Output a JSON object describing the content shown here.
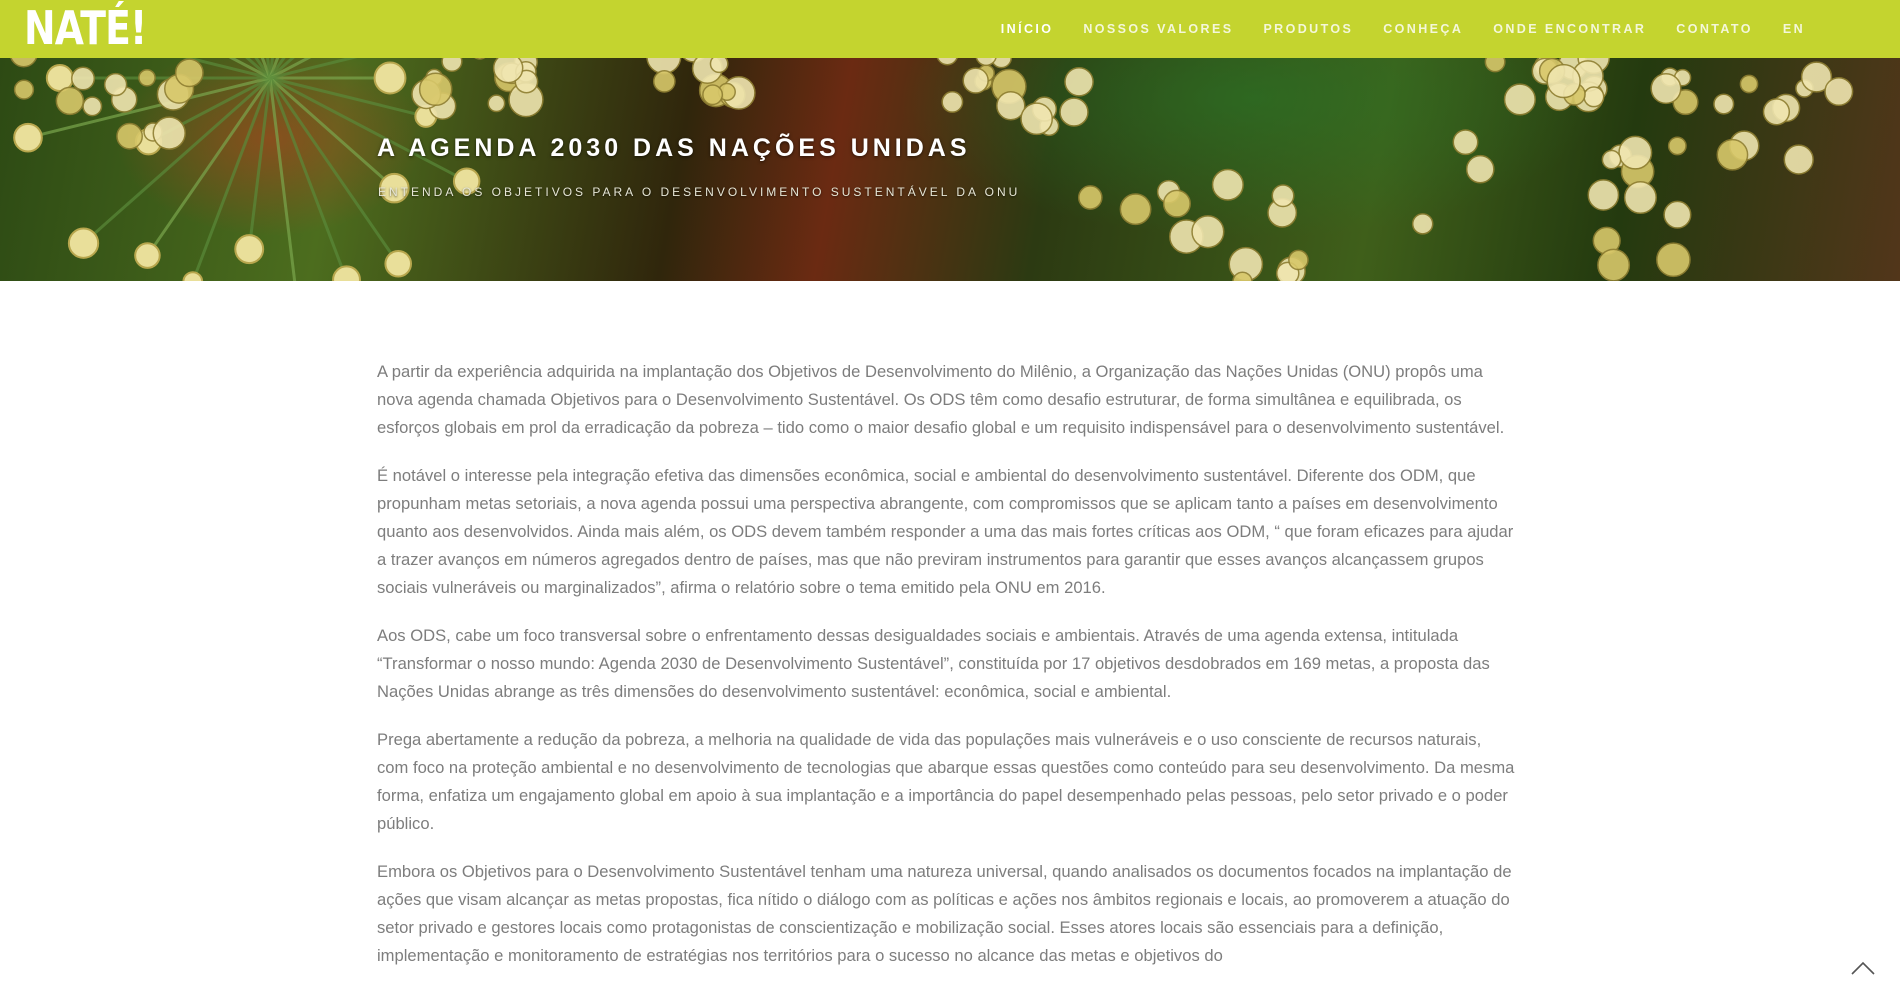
{
  "brand": {
    "logo_text": "NATÉ!"
  },
  "nav": {
    "items": [
      {
        "id": "inicio",
        "label": "INÍCIO",
        "active": true
      },
      {
        "id": "nossos-valores",
        "label": "NOSSOS VALORES",
        "active": false
      },
      {
        "id": "produtos",
        "label": "PRODUTOS",
        "active": false
      },
      {
        "id": "conheca",
        "label": "CONHEÇA",
        "active": false
      },
      {
        "id": "onde-encontrar",
        "label": "ONDE ENCONTRAR",
        "active": false
      },
      {
        "id": "contato",
        "label": "CONTATO",
        "active": false
      },
      {
        "id": "en",
        "label": "EN",
        "active": false
      }
    ]
  },
  "hero": {
    "title": "A AGENDA 2030 DAS NAÇÕES UNIDAS",
    "subtitle": "ENTENDA OS OBJETIVOS PARA O DESENVOLVIMENTO SUSTENTÁVEL DA ONU"
  },
  "article": {
    "paragraphs": [
      "A partir da experiência adquirida na implantação dos Objetivos de Desenvolvimento do Milênio, a Organização das Nações Unidas (ONU) propôs uma nova agenda chamada Objetivos para o Desenvolvimento Sustentável. Os ODS têm como desafio estruturar, de forma simultânea e equilibrada, os esforços globais em prol da erradicação da pobreza – tido como o maior desafio global e um requisito indispensável para o desenvolvimento sustentável.",
      "É notável o interesse pela integração efetiva das dimensões econômica, social e ambiental do desenvolvimento sustentável. Diferente dos ODM, que propunham metas setoriais, a nova agenda possui uma perspectiva abrangente, com compromissos que se aplicam tanto a países em desenvolvimento quanto aos desenvolvidos. Ainda mais além, os ODS devem também responder a uma das mais fortes críticas aos ODM, “ que foram eficazes para ajudar a trazer avanços em números agregados dentro de países, mas que não previram instrumentos para garantir que esses avanços alcançassem grupos sociais vulneráveis ou marginalizados”, afirma o relatório sobre o tema emitido pela ONU em 2016.",
      "Aos ODS, cabe um foco transversal sobre o enfrentamento dessas desigualdades sociais e ambientais. Através de uma agenda extensa, intitulada “Transformar o nosso mundo: Agenda 2030 de Desenvolvimento Sustentável”, constituída por 17 objetivos desdobrados em 169 metas, a proposta das Nações Unidas abrange as três dimensões do desenvolvimento sustentável: econômica, social e ambiental.",
      "Prega abertamente a redução da pobreza, a melhoria na qualidade de vida das populações mais vulneráveis e o uso consciente de recursos naturais, com foco na proteção ambiental e no desenvolvimento de tecnologias que abarque essas questões como conteúdo para seu desenvolvimento. Da mesma forma, enfatiza um engajamento global em apoio à sua implantação e a importância do papel desempenhado pelas pessoas, pelo setor privado e o poder público.",
      "Embora os Objetivos para o Desenvolvimento Sustentável tenham uma natureza universal, quando analisados os documentos focados na implantação de ações que visam alcançar as metas propostas, fica nítido o diálogo com as políticas e ações nos âmbitos regionais e locais, ao promoverem a atuação do setor privado e gestores locais como protagonistas de conscientização e mobilização social. Esses atores locais são essenciais para a definição, implementação e monitoramento de estratégias nos territórios para o sucesso no alcance das metas e objetivos do"
    ]
  },
  "back_to_top": {
    "icon": "chevron-up-icon"
  },
  "colors": {
    "header_bg": "#c4d42f",
    "nav_text": "#f4f7da",
    "body_text": "#7d7d7d",
    "hero_text": "#ffffff"
  }
}
